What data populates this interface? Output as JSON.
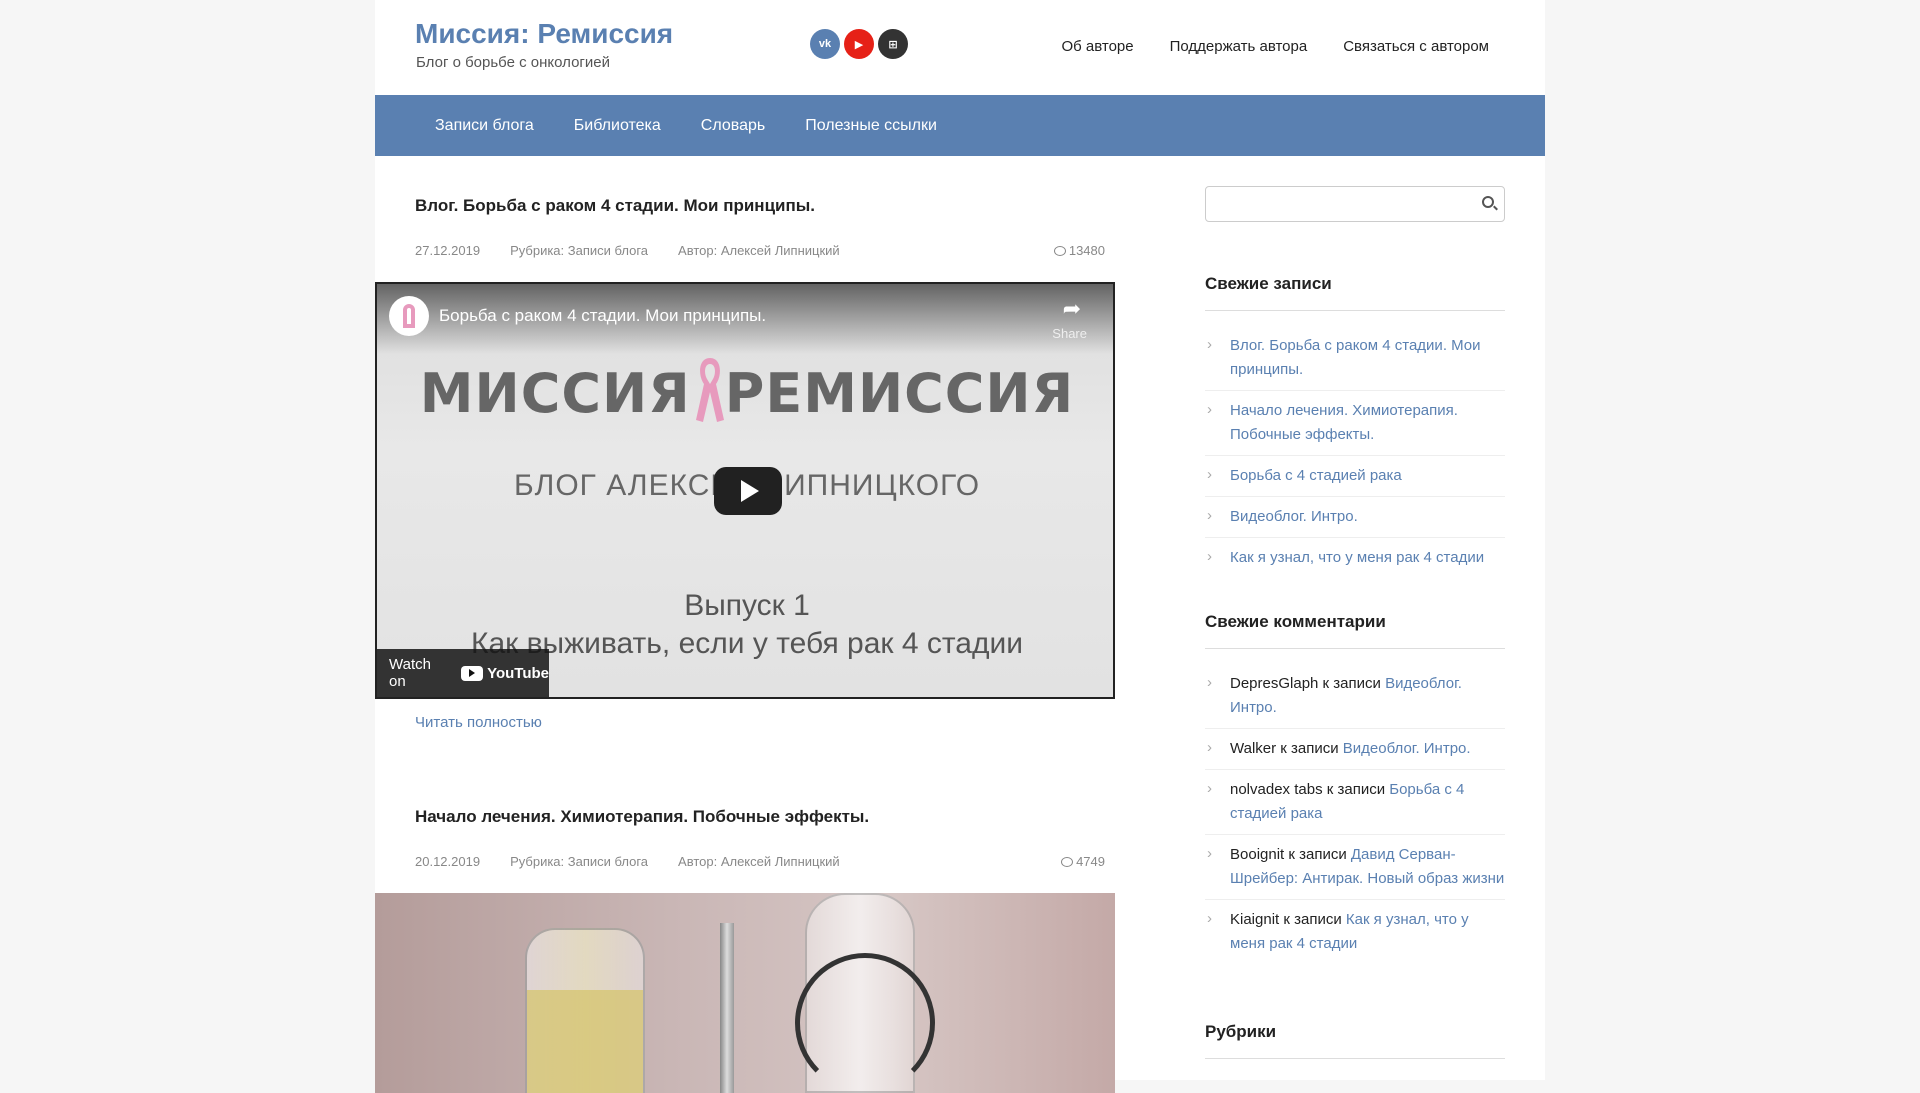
{
  "header": {
    "site_title": "Миссия: Ремиссия",
    "site_description": "Блог о борьбе с онкологией",
    "social": [
      {
        "name": "vk",
        "label": "vk"
      },
      {
        "name": "youtube",
        "label": "▶"
      },
      {
        "name": "odnoklassniki",
        "label": "⊞"
      }
    ],
    "top_nav": [
      "Об авторе",
      "Поддержать автора",
      "Связаться с автором"
    ]
  },
  "main_nav": [
    "Записи блога",
    "Библиотека",
    "Словарь",
    "Полезные ссылки"
  ],
  "posts": [
    {
      "title": "Влог. Борьба с раком 4 стадии. Мои принципы.",
      "date": "27.12.2019",
      "category": "Рубрика: Записи блога",
      "author": "Автор: Алексей Липницкий",
      "comments": "13480",
      "video": {
        "title": "Борьба с раком 4 стадии. Мои принципы.",
        "share_label": "Share",
        "brand_left": "МИССИЯ",
        "brand_right": "РЕМИССИЯ",
        "subtitle": "БЛОГ АЛЕКСЕЯ ЛИПНИЦКОГО",
        "episode": "Выпуск 1",
        "episode_sub": "Как выживать, если у тебя рак 4 стадии",
        "watch_on": "Watch on",
        "youtube": "YouTube"
      },
      "read_more": "Читать полностью"
    },
    {
      "title": "Начало лечения. Химиотерапия. Побочные эффекты.",
      "date": "20.12.2019",
      "category": "Рубрика: Записи блога",
      "author": "Автор: Алексей Липницкий",
      "comments": "4749"
    }
  ],
  "sidebar": {
    "search_placeholder": "",
    "recent_posts_title": "Свежие записи",
    "recent_posts": [
      "Влог. Борьба с раком 4 стадии. Мои принципы.",
      "Начало лечения. Химиотерапия. Побочные эффекты.",
      "Борьба с 4 стадией рака",
      "Видеоблог. Интро.",
      "Как я узнал, что у меня рак 4 стадии"
    ],
    "recent_comments_title": "Свежие комментарии",
    "recent_comments": [
      {
        "author": "DepresGlaph",
        "connector": " к записи ",
        "post": "Видеоблог. Интро."
      },
      {
        "author": "Walker",
        "connector": " к записи ",
        "post": "Видеоблог. Интро."
      },
      {
        "author": "nolvadex tabs",
        "connector": " к записи ",
        "post": "Борьба с 4 стадией рака"
      },
      {
        "author": "Booignit",
        "connector": " к записи ",
        "post": "Давид Серван-Шрейбер: Антирак. Новый образ жизни"
      },
      {
        "author": "Kiaignit",
        "connector": " к записи ",
        "post": "Как я узнал, что у меня рак 4 стадии"
      }
    ],
    "categories_title": "Рубрики"
  },
  "colors": {
    "accent": "#5a80b1",
    "youtube": "#e62117"
  }
}
